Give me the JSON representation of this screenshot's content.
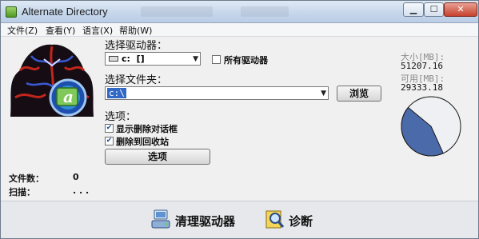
{
  "window": {
    "title": "Alternate Directory"
  },
  "menu": [
    "文件(Z)",
    "查看(Y)",
    "语言(X)",
    "帮助(W)"
  ],
  "drive": {
    "label": "选择驱动器：",
    "selected": "c:  []",
    "all_drives_label": "所有驱动器",
    "all_drives_checked": false
  },
  "folder": {
    "label": "选择文件夹：",
    "value": "c:\\",
    "browse_label": "浏览"
  },
  "options": {
    "label": "选项：",
    "show_delete_dialog_label": "显示删除对话框",
    "show_delete_dialog_checked": true,
    "recycle_label": "删除到回收站",
    "recycle_checked": true,
    "options_button_label": "选项"
  },
  "stats": {
    "files_label": "文件数：",
    "files_value": "0",
    "scan_label": "扫描：",
    "scan_value": ". . ."
  },
  "disk": {
    "size_label": "大小[MB]:",
    "size_value": "51207.16",
    "free_label": "可用[MB]:",
    "free_value": "29333.18",
    "used_fraction": 0.4272,
    "used_color": "#4b6aa9",
    "free_color": "#eef0f4"
  },
  "actions": {
    "clean_label": "清理驱动器",
    "diagnose_label": "诊断"
  },
  "colors": {
    "title_bar": "#c9d9ec",
    "close_button": "#c7412c"
  },
  "icons": [
    "app-icon",
    "drive-icon",
    "clean-drive-icon",
    "diagnose-icon",
    "alternate-directory-logo"
  ]
}
